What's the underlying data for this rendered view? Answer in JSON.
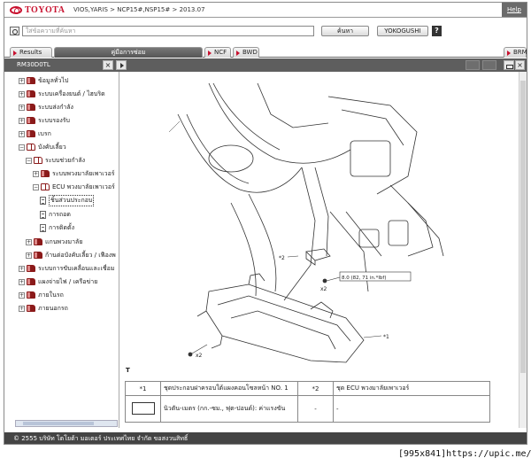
{
  "brand": {
    "name": "TOYOTA",
    "accent": "#c8102e"
  },
  "breadcrumb": "VIOS,YARIS > NCP15#,NSP15# > 2013.07",
  "help_label": "Help",
  "search": {
    "placeholder": "ใส่ข้อความที่ค้นหา",
    "button_label": "ค้นหา",
    "yokogushi_label": "YOKOGUSHI",
    "help_icon": "?"
  },
  "tabs": [
    {
      "label": "Results"
    },
    {
      "label": "คู่มือการซ่อม"
    },
    {
      "label": "NCF"
    },
    {
      "label": "BWD"
    },
    {
      "label": "BRM"
    }
  ],
  "toolbar": {
    "doc_id": "RM30D0TL",
    "close_glyph": "×"
  },
  "sidebar": {
    "items": [
      {
        "label": "ข้อมูลทั่วไป",
        "exp": "+",
        "icon": "book"
      },
      {
        "label": "ระบบเครื่องยนต์ / ไฮบริด",
        "exp": "+",
        "icon": "book"
      },
      {
        "label": "ระบบส่งกำลัง",
        "exp": "+",
        "icon": "book"
      },
      {
        "label": "ระบบรองรับ",
        "exp": "+",
        "icon": "book"
      },
      {
        "label": "เบรก",
        "exp": "+",
        "icon": "book"
      },
      {
        "label": "บังคับเลี้ยว",
        "exp": "−",
        "icon": "book-open"
      },
      {
        "label": "ระบบช่วยกำลัง",
        "exp": "−",
        "icon": "book-open"
      },
      {
        "label": "ระบบพวงมาลัยเพาเวอร์",
        "exp": "+",
        "icon": "book"
      },
      {
        "label": "ECU พวงมาลัยเพาเวอร์",
        "exp": "−",
        "icon": "book-open"
      },
      {
        "label": "ชิ้นส่วนประกอบ",
        "exp": "",
        "icon": "doc"
      },
      {
        "label": "การถอด",
        "exp": "",
        "icon": "doc"
      },
      {
        "label": "การติดตั้ง",
        "exp": "",
        "icon": "doc"
      },
      {
        "label": "แกนพวงมาลัย",
        "exp": "+",
        "icon": "book"
      },
      {
        "label": "ก้านต่อบังคับเลี้ยว / เฟืองพ",
        "exp": "+",
        "icon": "book"
      },
      {
        "label": "ระบบการขับเคลื่อนและเชื่อม",
        "exp": "+",
        "icon": "book"
      },
      {
        "label": "แผงจ่ายไฟ / เครือข่าย",
        "exp": "+",
        "icon": "book"
      },
      {
        "label": "ภายในรถ",
        "exp": "+",
        "icon": "book"
      },
      {
        "label": "ภายนอกรถ",
        "exp": "+",
        "icon": "book"
      }
    ]
  },
  "diagram": {
    "callouts": {
      "c1": "*1",
      "c2": "*2",
      "x2a": "x2",
      "x2b": "x2"
    },
    "torque": "8.0 (82, 71 in.*lbf)",
    "marker": "T"
  },
  "legend_table": {
    "row1": {
      "n1": "*1",
      "t1": "ชุดประกอบฝาครอบใต้แผงคอนโซลหน้า NO. 1",
      "n2": "*2",
      "t2": "ชุด ECU พวงมาลัยเพาเวอร์"
    },
    "row2": {
      "t1": "นิวตัน-เมตร (กก.-ซม., ฟุต-ปอนด์): ค่าแรงขัน",
      "n2": "-",
      "t2": "-"
    }
  },
  "footer": "© 2555 บริษัท โตโยต้า มอเตอร์ ประเทศไทย จำกัด ขอสงวนสิทธิ์",
  "watermark": "[995x841]https://upic.me/"
}
